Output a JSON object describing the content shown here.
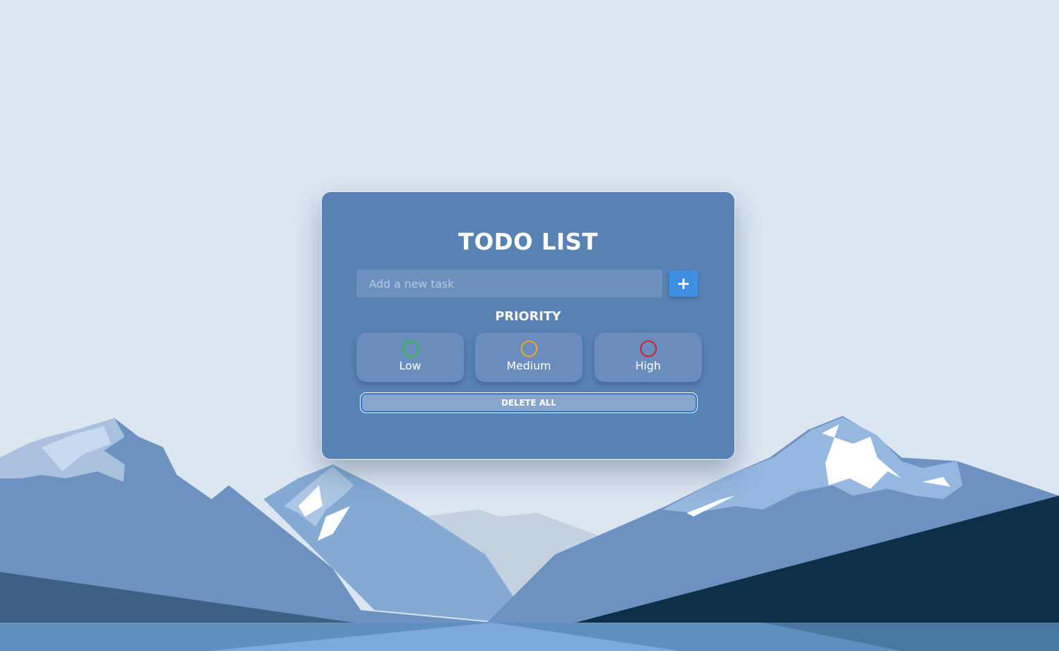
{
  "app": {
    "title": "TODO LIST"
  },
  "task_input": {
    "placeholder": "Add a new task",
    "value": ""
  },
  "add_button": {
    "label": "+"
  },
  "priority": {
    "heading": "PRIORITY",
    "options": [
      {
        "label": "Low",
        "color": "#2ec13a",
        "icon": "circle-outline-icon"
      },
      {
        "label": "Medium",
        "color": "#f0a91a",
        "icon": "circle-outline-icon"
      },
      {
        "label": "High",
        "color": "#d81c1c",
        "icon": "circle-outline-icon"
      }
    ]
  },
  "delete_all": {
    "label": "DELETE ALL"
  },
  "colors": {
    "card_bg": "#5982b4",
    "accent": "#3f90e4",
    "sky": "#dbe6f1"
  }
}
